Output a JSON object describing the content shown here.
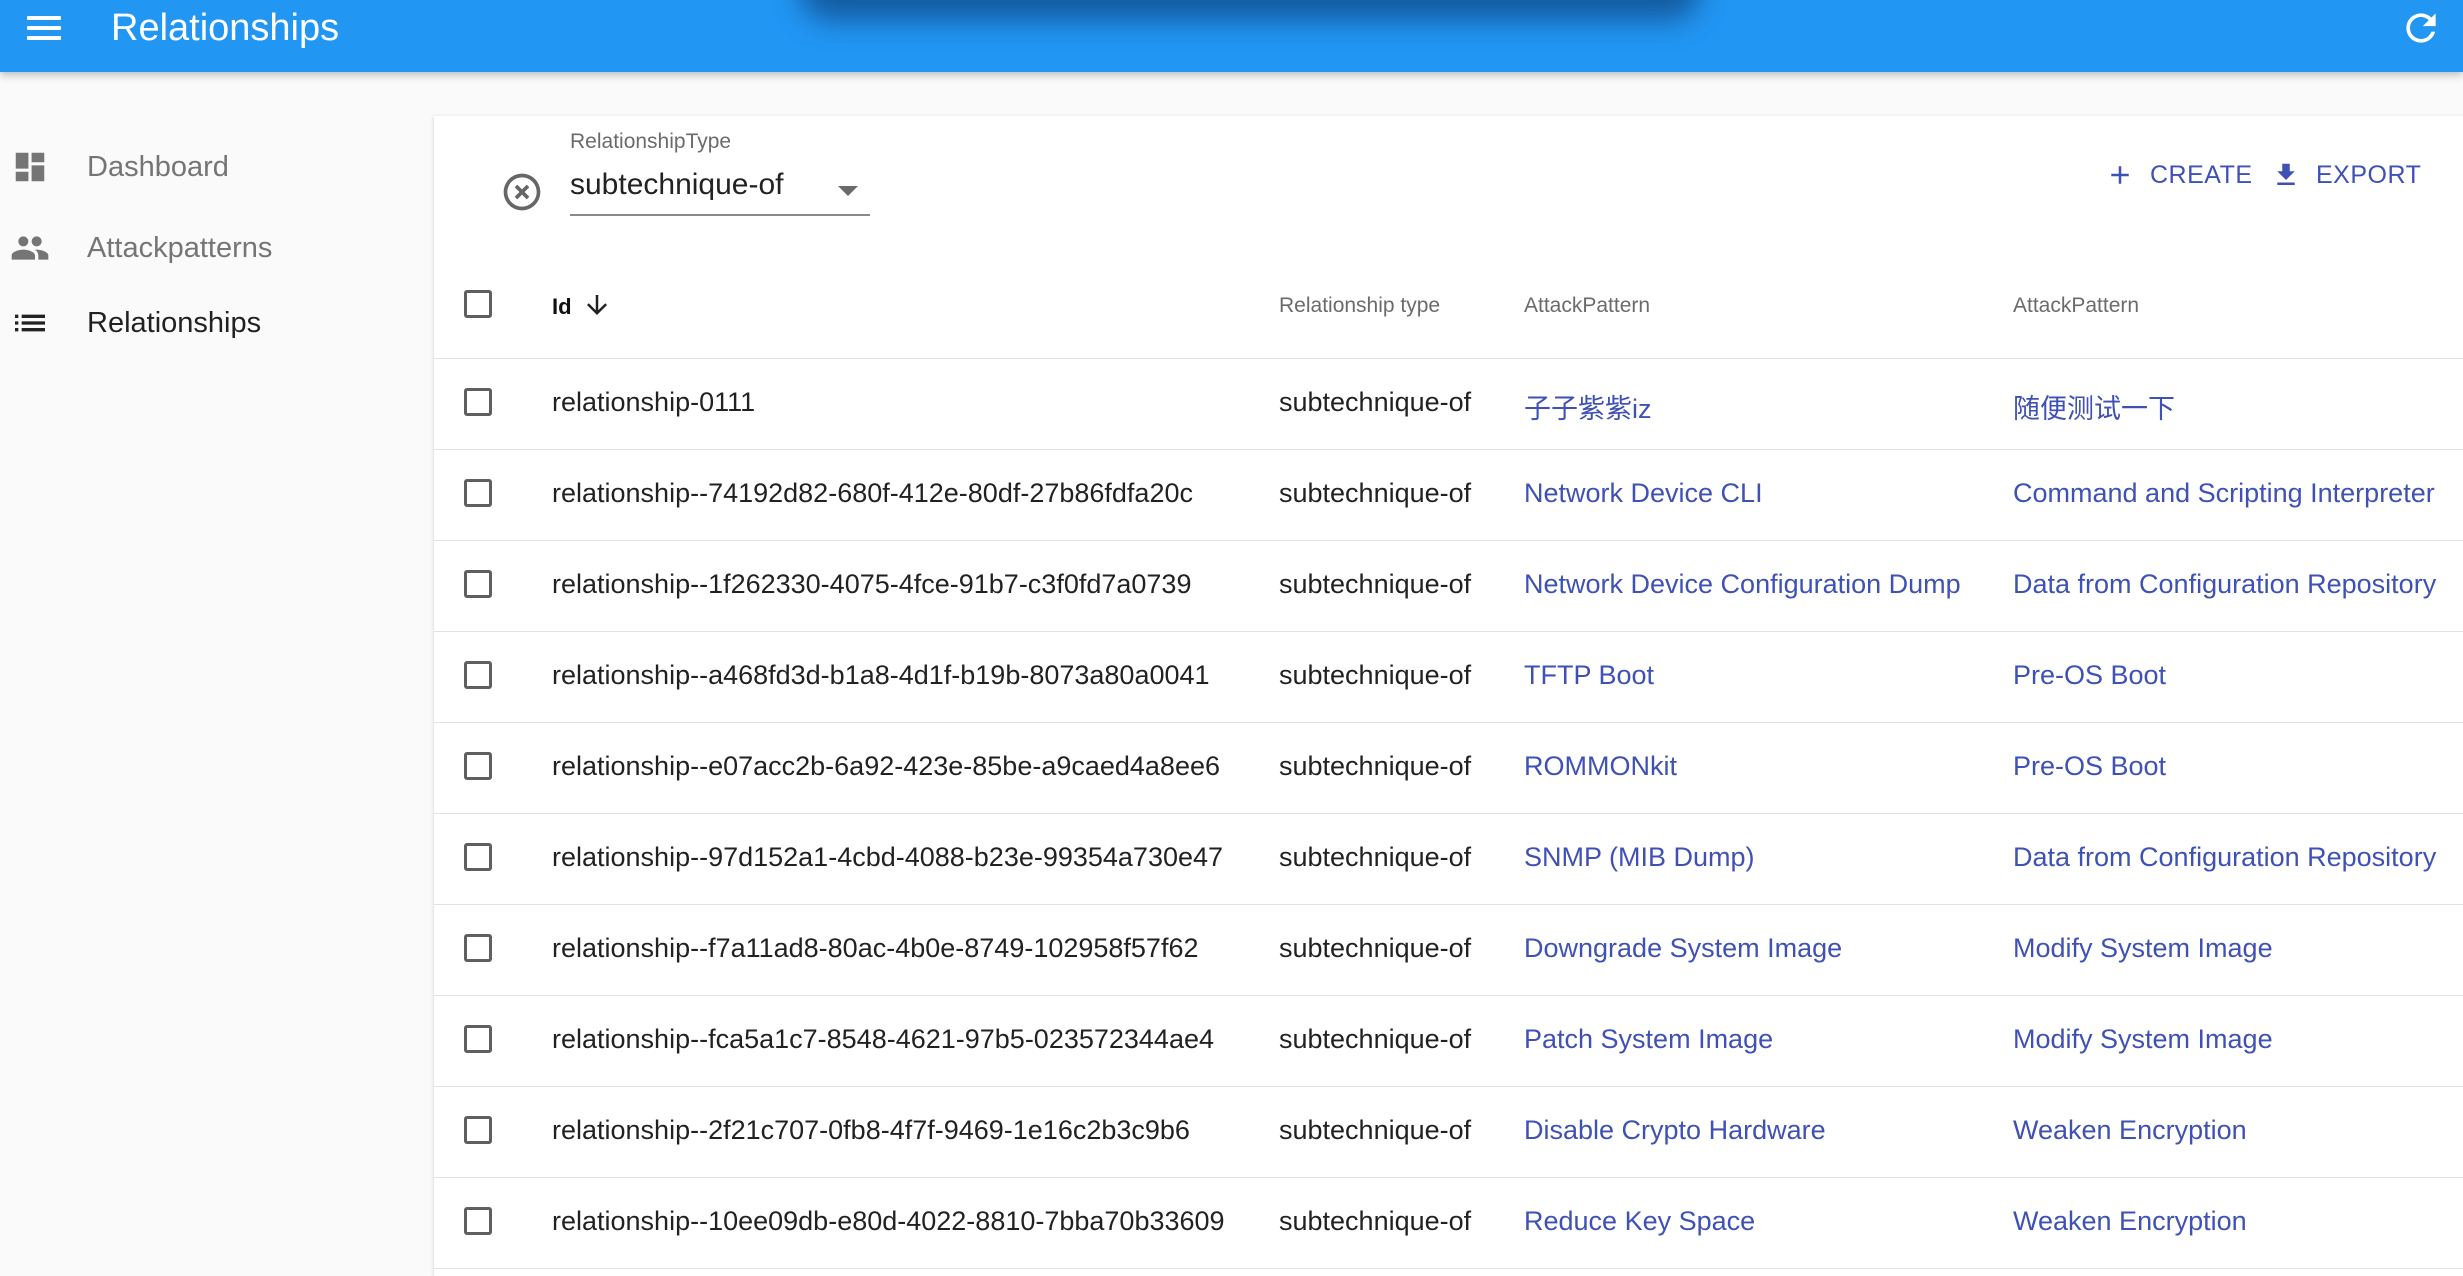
{
  "app": {
    "title": "Relationships"
  },
  "sidebar": {
    "items": [
      {
        "label": "Dashboard",
        "icon": "dashboard-icon"
      },
      {
        "label": "Attackpatterns",
        "icon": "people-icon"
      },
      {
        "label": "Relationships",
        "icon": "list-icon",
        "active": true
      }
    ]
  },
  "filter": {
    "label": "RelationshipType",
    "value": "subtechnique-of"
  },
  "actions": {
    "create_label": "CREATE",
    "export_label": "EXPORT"
  },
  "colors": {
    "appbar": "#2196f3",
    "accent": "#3f51b5"
  },
  "table": {
    "headers": {
      "id": "Id",
      "relationship_type": "Relationship type",
      "source": "AttackPattern",
      "target": "AttackPattern"
    },
    "sort": {
      "column": "id",
      "direction": "descending"
    },
    "rows": [
      {
        "id": "relationship-0111",
        "type": "subtechnique-of",
        "source": "子子紫紫iz",
        "target": "随便测试一下"
      },
      {
        "id": "relationship--74192d82-680f-412e-80df-27b86fdfa20c",
        "type": "subtechnique-of",
        "source": "Network Device CLI",
        "target": "Command and Scripting Interpreter"
      },
      {
        "id": "relationship--1f262330-4075-4fce-91b7-c3f0fd7a0739",
        "type": "subtechnique-of",
        "source": "Network Device Configuration Dump",
        "target": "Data from Configuration Repository"
      },
      {
        "id": "relationship--a468fd3d-b1a8-4d1f-b19b-8073a80a0041",
        "type": "subtechnique-of",
        "source": "TFTP Boot",
        "target": "Pre-OS Boot"
      },
      {
        "id": "relationship--e07acc2b-6a92-423e-85be-a9caed4a8ee6",
        "type": "subtechnique-of",
        "source": "ROMMONkit",
        "target": "Pre-OS Boot"
      },
      {
        "id": "relationship--97d152a1-4cbd-4088-b23e-99354a730e47",
        "type": "subtechnique-of",
        "source": "SNMP (MIB Dump)",
        "target": "Data from Configuration Repository"
      },
      {
        "id": "relationship--f7a11ad8-80ac-4b0e-8749-102958f57f62",
        "type": "subtechnique-of",
        "source": "Downgrade System Image",
        "target": "Modify System Image"
      },
      {
        "id": "relationship--fca5a1c7-8548-4621-97b5-023572344ae4",
        "type": "subtechnique-of",
        "source": "Patch System Image",
        "target": "Modify System Image"
      },
      {
        "id": "relationship--2f21c707-0fb8-4f7f-9469-1e16c2b3c9b6",
        "type": "subtechnique-of",
        "source": "Disable Crypto Hardware",
        "target": "Weaken Encryption"
      },
      {
        "id": "relationship--10ee09db-e80d-4022-8810-7bba70b33609",
        "type": "subtechnique-of",
        "source": "Reduce Key Space",
        "target": "Weaken Encryption"
      }
    ]
  }
}
